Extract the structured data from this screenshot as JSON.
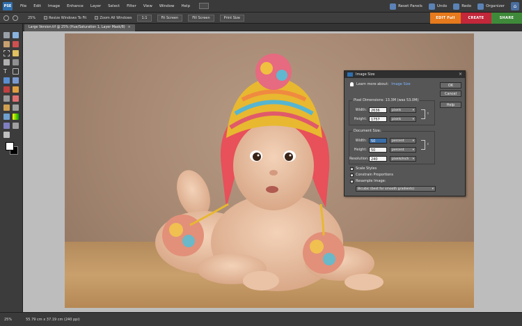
{
  "menubar": {
    "logo": "PSE",
    "menus": [
      "File",
      "Edit",
      "Image",
      "Enhance",
      "Layer",
      "Select",
      "Filter",
      "View",
      "Window",
      "Help"
    ],
    "reset_panels": "Reset Panels",
    "undo": "Undo",
    "redo": "Redo",
    "organizer": "Organizer"
  },
  "optionsbar": {
    "zoom": "25%",
    "resize_windows": "Resize Windows To Fit",
    "zoom_all": "Zoom All Windows",
    "btn_1to1": "1:1",
    "fit_screen": "Fit Screen",
    "fill_screen": "Fill Screen",
    "print_size": "Print Size",
    "modes": [
      "EDIT Full",
      "CREATE",
      "SHARE"
    ]
  },
  "document": {
    "tab_title": "Large Version.tif @ 25% (Hue/Saturation 1, Layer Mask/8)",
    "tab_close": "×"
  },
  "statusbar": {
    "zoom": "25%",
    "doc_info": "55.79 cm x 37.19 cm (240 ppi)"
  },
  "dialog": {
    "title": "Image Size",
    "close": "×",
    "learn_more": "Learn more about:",
    "learn_link": "Image Size",
    "buttons": {
      "ok": "OK",
      "cancel": "Cancel",
      "help": "Help"
    },
    "pixel_dimensions": {
      "title": "Pixel Dimensions: 13.3M (was 53.0M)",
      "width_label": "Width:",
      "width_value": "2636",
      "width_unit": "pixels",
      "height_label": "Height:",
      "height_value": "1757",
      "height_unit": "pixels"
    },
    "document_size": {
      "title": "Document Size:",
      "width_label": "Width:",
      "width_value": "50",
      "width_unit": "percent",
      "height_label": "Height:",
      "height_value": "50",
      "height_unit": "percent",
      "resolution_label": "Resolution:",
      "resolution_value": "240",
      "resolution_unit": "pixels/inch"
    },
    "scale_styles": "Scale Styles",
    "constrain": "Constrain Proportions",
    "resample": "Resample Image:",
    "resample_method": "Bicubic (best for smooth gradients)"
  }
}
